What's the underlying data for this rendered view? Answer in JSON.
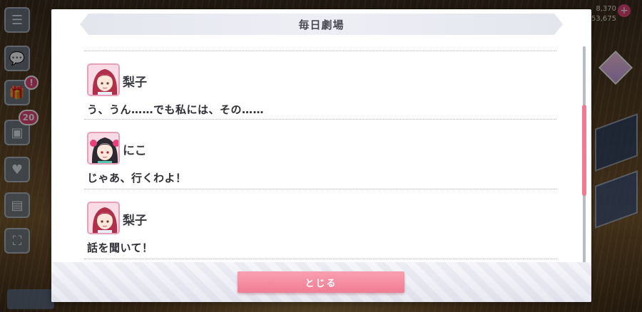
{
  "dialog": {
    "title": "毎日劇場",
    "close_label": "とじる"
  },
  "log": [
    {
      "speaker": "梨子",
      "avatar": "riko-avatar-icon",
      "text": "う、うん……でも私には、その……"
    },
    {
      "speaker": "にこ",
      "avatar": "nico-avatar-icon",
      "text": "じゃあ、行くわよ！"
    },
    {
      "speaker": "梨子",
      "avatar": "riko-avatar-icon",
      "text": "話を聞いて！"
    }
  ],
  "hud": {
    "count_badge": "20",
    "top_counter_1": "8,370",
    "top_counter_2": "53,675",
    "notify_mark": "!"
  },
  "colors": {
    "accent": "#f07c93",
    "title_text": "#4a4a52",
    "scroll_thumb": "#f07a92"
  }
}
